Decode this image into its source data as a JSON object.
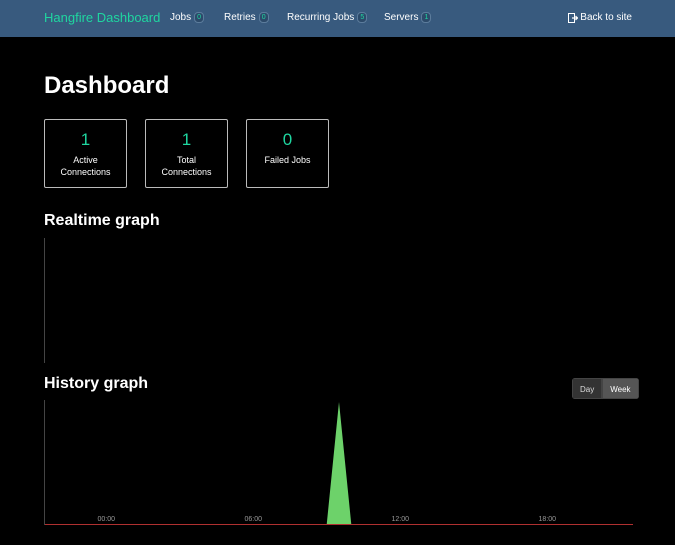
{
  "navbar": {
    "brand": "Hangfire Dashboard",
    "items": [
      {
        "label": "Jobs",
        "count": "0"
      },
      {
        "label": "Retries",
        "count": "0"
      },
      {
        "label": "Recurring Jobs",
        "count": "5"
      },
      {
        "label": "Servers",
        "count": "1"
      }
    ],
    "back_label": "Back to site"
  },
  "page": {
    "title": "Dashboard"
  },
  "metrics": [
    {
      "value": "1",
      "label": "Active Connections"
    },
    {
      "value": "1",
      "label": "Total Connections"
    },
    {
      "value": "0",
      "label": "Failed Jobs"
    }
  ],
  "realtime": {
    "title": "Realtime graph"
  },
  "history": {
    "title": "History graph",
    "toggle": {
      "day": "Day",
      "week": "Week",
      "active": "Week"
    }
  },
  "chart_data": {
    "type": "area",
    "xlabel": "",
    "ylabel": "",
    "x_ticks": [
      "00:00",
      "06:00",
      "12:00",
      "18:00"
    ],
    "x": [
      0,
      11.5,
      12,
      12.5,
      24
    ],
    "series": [
      {
        "values": [
          0,
          0,
          1,
          0,
          0
        ],
        "color": "#6dd26a"
      }
    ],
    "xlim": [
      0,
      24
    ],
    "ylim": [
      0,
      1
    ],
    "failed_line_color": "#b03030",
    "grid": false
  }
}
